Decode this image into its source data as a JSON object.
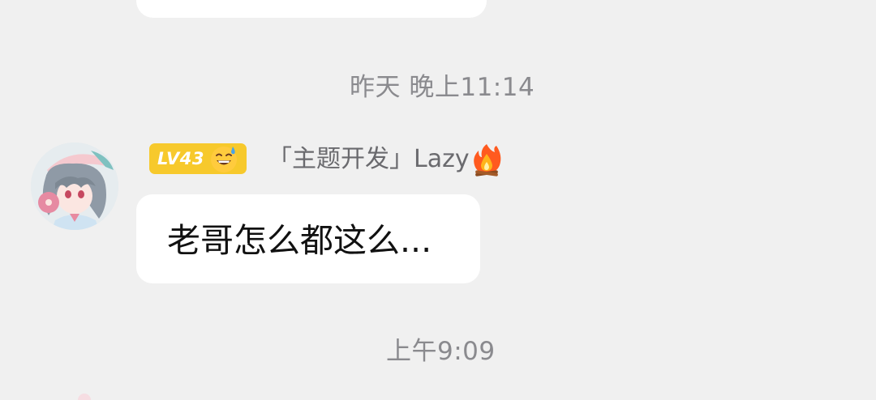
{
  "messages": {
    "timestamp_1": "昨天 晚上11:14",
    "timestamp_2": "上午9:09",
    "sender": {
      "level": "LV43",
      "level_color": "#f7c92c",
      "badge_emoji": "grinning-sweat-icon",
      "name": "「主题开发」Lazy",
      "flair_icon": "fire-icon"
    },
    "message_text": "老哥怎么都这么..."
  }
}
